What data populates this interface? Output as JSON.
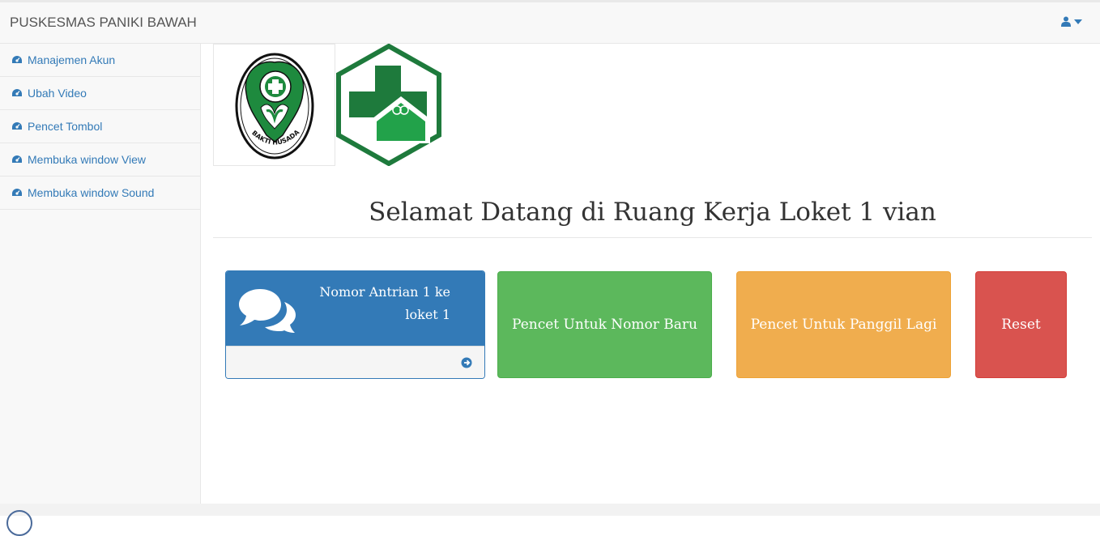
{
  "navbar": {
    "brand": "PUSKESMAS PANIKI BAWAH",
    "user_icon": "user-icon",
    "caret_icon": "caret-down-icon"
  },
  "sidebar": {
    "items": [
      {
        "label": "Manajemen Akun",
        "icon": "dashboard-icon"
      },
      {
        "label": "Ubah Video",
        "icon": "dashboard-icon"
      },
      {
        "label": "Pencet Tombol",
        "icon": "dashboard-icon"
      },
      {
        "label": "Membuka window View",
        "icon": "dashboard-icon"
      },
      {
        "label": "Membuka window Sound",
        "icon": "dashboard-icon"
      }
    ]
  },
  "logos": {
    "bakti_husada_text": "BAKTI HUSADA"
  },
  "main": {
    "welcome": "Selamat Datang di Ruang Kerja Loket 1 vian",
    "queue_panel": {
      "title": "Nomor Antrian 1 ke loket 1",
      "icon": "comments-icon"
    },
    "buttons": {
      "new_number": "Pencet Untuk Nomor Baru",
      "call_again": "Pencet Untuk Panggil Lagi",
      "reset": "Reset"
    }
  },
  "colors": {
    "primary": "#337ab7",
    "success": "#5cb85c",
    "warning": "#f0ad4e",
    "danger": "#d9534f",
    "logo_green": "#1e7a3c"
  }
}
